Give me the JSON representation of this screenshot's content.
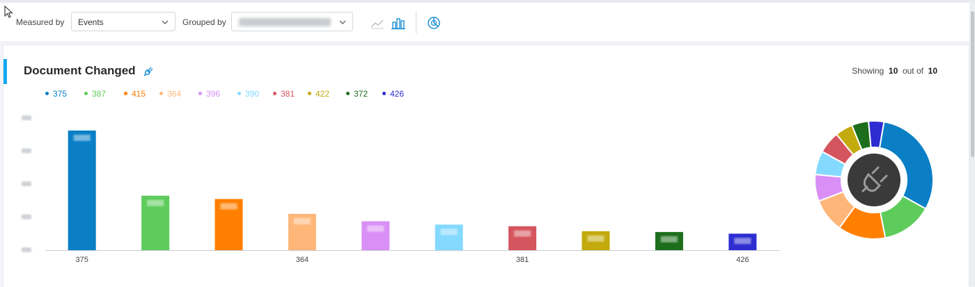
{
  "toolbar": {
    "measured_by_label": "Measured by",
    "measured_by_value": "Events",
    "grouped_by_label": "Grouped by",
    "grouped_by_value": "",
    "icons": [
      "line-chart-icon",
      "bar-chart-icon",
      "pie-chart-icon",
      "chevron-down-icon"
    ]
  },
  "card": {
    "title": "Document Changed",
    "showing_prefix": "Showing",
    "showing_count": "10",
    "showing_mid": "out of",
    "showing_total": "10"
  },
  "legend": [
    {
      "label": "375",
      "color": "#0a7fc6"
    },
    {
      "label": "387",
      "color": "#5dcc5b"
    },
    {
      "label": "415",
      "color": "#ff7f00"
    },
    {
      "label": "364",
      "color": "#ffb679"
    },
    {
      "label": "396",
      "color": "#d98ff5"
    },
    {
      "label": "390",
      "color": "#84d9ff"
    },
    {
      "label": "381",
      "color": "#d5555e"
    },
    {
      "label": "422",
      "color": "#c3aa0d"
    },
    {
      "label": "372",
      "color": "#1c6e1c"
    },
    {
      "label": "426",
      "color": "#2d2dd1"
    }
  ],
  "chart_data": {
    "type": "bar",
    "categories": [
      "375",
      "387",
      "415",
      "364",
      "396",
      "390",
      "381",
      "422",
      "372",
      "426"
    ],
    "x_tick_labels_shown": [
      "375",
      "364",
      "381",
      "426"
    ],
    "values": [
      145,
      66,
      62,
      44,
      35,
      31,
      29,
      23,
      22,
      20
    ],
    "colors": [
      "#0a7fc6",
      "#5dcc5b",
      "#ff7f00",
      "#ffb679",
      "#d98ff5",
      "#84d9ff",
      "#d5555e",
      "#c3aa0d",
      "#1c6e1c",
      "#2d2dd1"
    ],
    "ylim": [
      0,
      160
    ],
    "yticks": [
      0,
      40,
      80,
      120,
      160
    ],
    "grid": false,
    "legend_position": "top-left"
  },
  "donut": {
    "center_icon": "plug-icon",
    "values": [
      145,
      66,
      62,
      44,
      35,
      31,
      29,
      23,
      22,
      20
    ]
  }
}
